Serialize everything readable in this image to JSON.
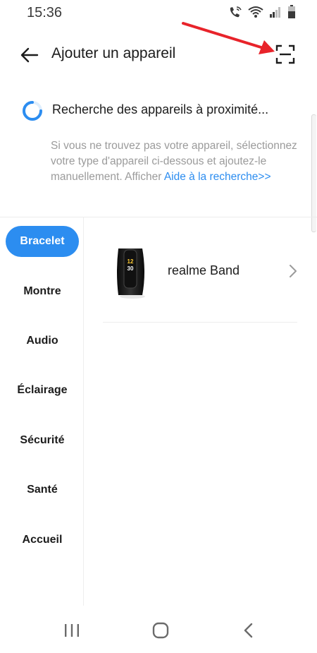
{
  "status_bar": {
    "time": "15:36"
  },
  "header": {
    "title": "Ajouter un appareil",
    "back_icon": "arrow-left-icon",
    "scan_icon": "scan-icon"
  },
  "search": {
    "status_text": "Recherche des appareils à proximité...",
    "help_text": "Si vous ne trouvez pas votre appareil, sélectionnez votre type d'appareil ci-dessous et ajoutez-le manuellement. Afficher ",
    "help_link": "Aide à la recherche>>"
  },
  "categories": [
    {
      "label": "Bracelet",
      "active": true
    },
    {
      "label": "Montre",
      "active": false
    },
    {
      "label": "Audio",
      "active": false
    },
    {
      "label": "Éclairage",
      "active": false
    },
    {
      "label": "Sécurité",
      "active": false
    },
    {
      "label": "Santé",
      "active": false
    },
    {
      "label": "Accueil",
      "active": false
    }
  ],
  "devices": [
    {
      "name": "realme Band",
      "screen_time_h": "12",
      "screen_time_m": "30"
    }
  ],
  "colors": {
    "accent": "#2c8df0",
    "annotation_arrow": "#e8232a"
  }
}
